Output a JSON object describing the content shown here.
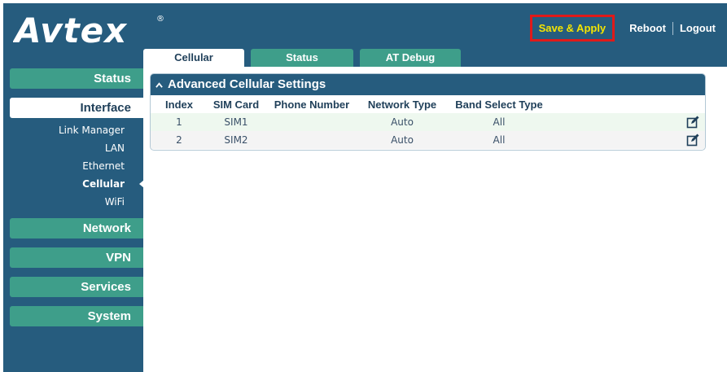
{
  "brand": {
    "logo_text": "Avtex",
    "registered_mark": "®"
  },
  "topbar": {
    "save_apply": "Save & Apply",
    "reboot": "Reboot",
    "logout": "Logout"
  },
  "sidebar": {
    "status": "Status",
    "interface": "Interface",
    "interface_items": [
      "Link Manager",
      "LAN",
      "Ethernet",
      "Cellular",
      "WiFi"
    ],
    "network": "Network",
    "vpn": "VPN",
    "services": "Services",
    "system": "System"
  },
  "tabs": [
    "Cellular",
    "Status",
    "AT Debug"
  ],
  "panel": {
    "title": "Advanced Cellular Settings",
    "columns": [
      "Index",
      "SIM Card",
      "Phone Number",
      "Network Type",
      "Band Select Type"
    ],
    "rows": [
      {
        "index": "1",
        "sim": "SIM1",
        "phone": "",
        "network_type": "Auto",
        "band": "All"
      },
      {
        "index": "2",
        "sim": "SIM2",
        "phone": "",
        "network_type": "Auto",
        "band": "All"
      }
    ]
  },
  "colors": {
    "accent": "#3e9e8a",
    "header_blue": "#265c7e",
    "highlight_box": "#e01a1a",
    "save_text": "#f5e400"
  },
  "icons": {
    "collapse": "chevron-up-icon",
    "edit": "edit-icon"
  }
}
